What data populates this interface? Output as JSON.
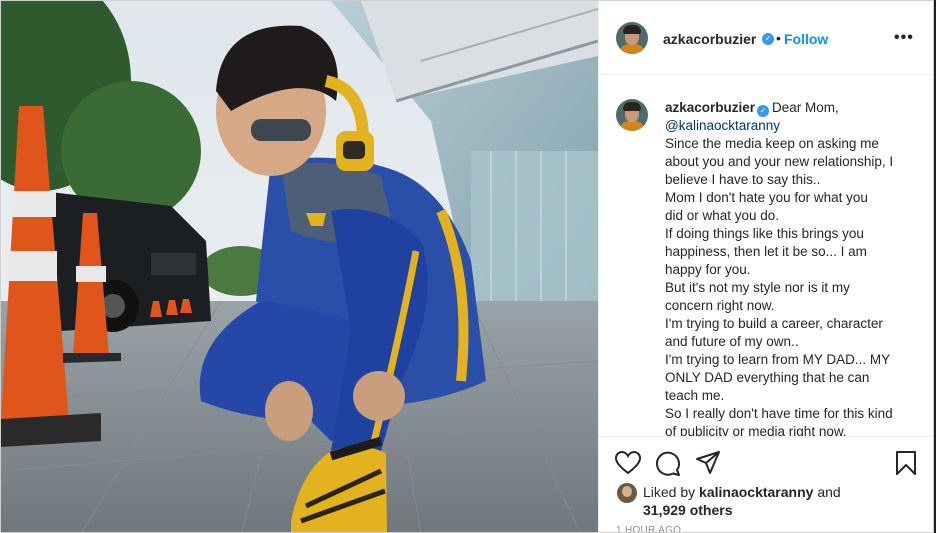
{
  "post": {
    "username": "azkacorbuzier",
    "follow_label": "Follow",
    "more_label": "•••",
    "separator": "•"
  },
  "caption": {
    "username": "azkacorbuzier",
    "greeting": "Dear Mom,",
    "mention": "@kalinaocktaranny",
    "lines": [
      "Since the media keep on asking me",
      "about you and your new relationship, I",
      "believe I have to say this..",
      "Mom I don't hate you for what you",
      "did or what you do.",
      "If doing things like this brings you",
      "happiness, then let it be so... I am",
      "happy for you.",
      "But it's not my style nor is it my",
      "concern right now.",
      "I'm trying to build a career, character",
      "and future of my own..",
      "I'm trying to learn from MY DAD... MY",
      "ONLY DAD everything that he can",
      "teach me.",
      "So I really don't have time for this kind",
      "of publicity or media right now."
    ]
  },
  "actions": {
    "like_icon": "heart-icon",
    "comment_icon": "comment-icon",
    "share_icon": "paper-plane-icon",
    "save_icon": "bookmark-icon"
  },
  "likes": {
    "prefix": "Liked by",
    "user": "kalinaocktaranny",
    "and": "and",
    "count": "31,929 others"
  },
  "timestamp": "1 HOUR AGO",
  "colors": {
    "accent": "#0095f6",
    "verified": "#3897f0",
    "text": "#262626",
    "muted": "#8e8e8e"
  }
}
